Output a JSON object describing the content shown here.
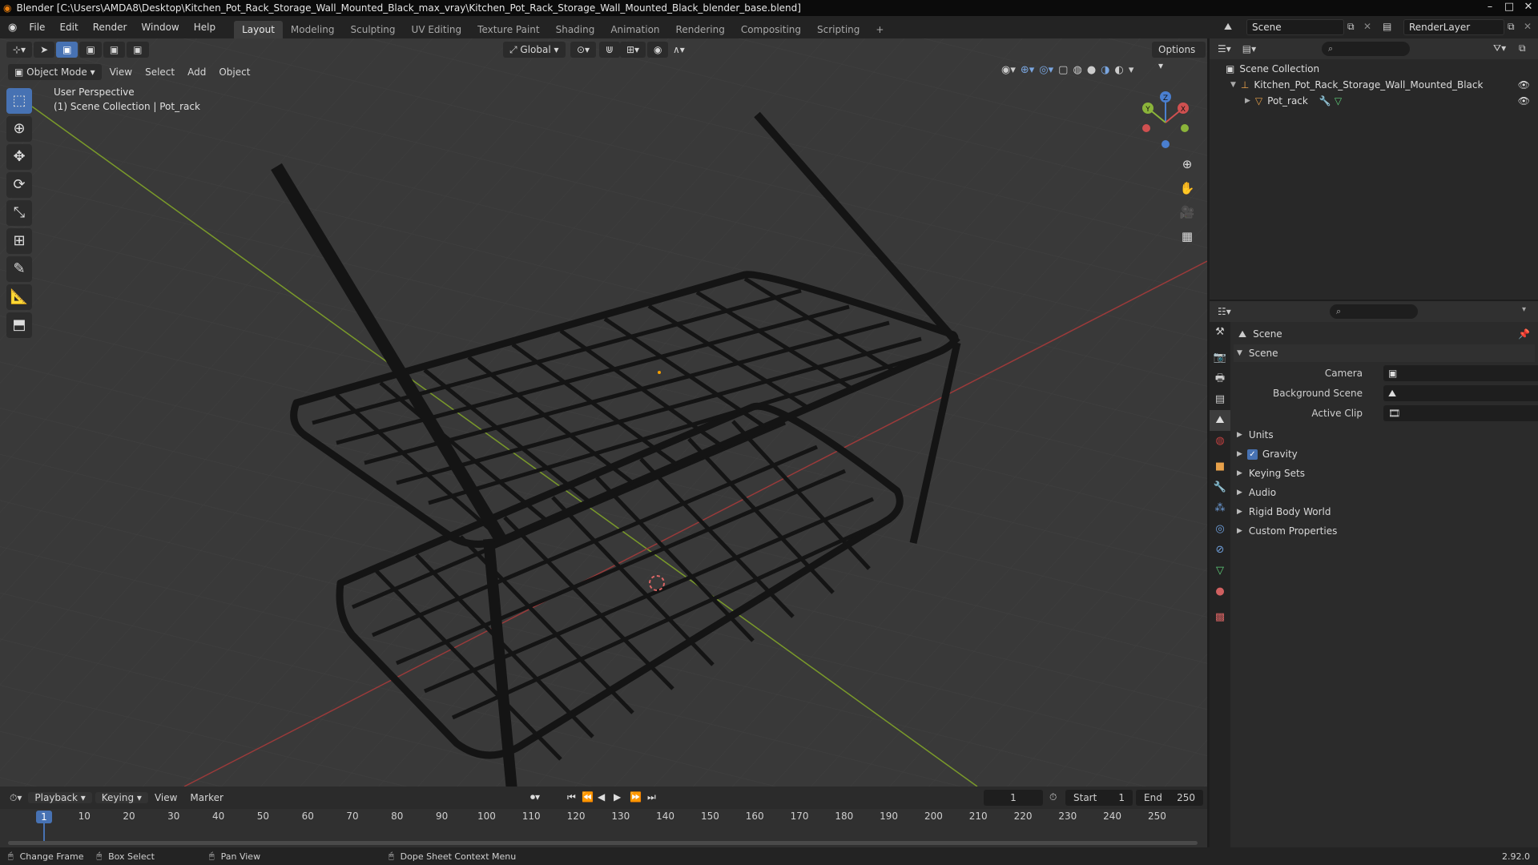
{
  "window": {
    "title": "Blender [C:\\Users\\AMDA8\\Desktop\\Kitchen_Pot_Rack_Storage_Wall_Mounted_Black_max_vray\\Kitchen_Pot_Rack_Storage_Wall_Mounted_Black_blender_base.blend]",
    "minimize": "–",
    "maximize": "□",
    "close": "✕"
  },
  "menubar": {
    "items": [
      "File",
      "Edit",
      "Render",
      "Window",
      "Help"
    ],
    "workspaces": [
      "Layout",
      "Modeling",
      "Sculpting",
      "UV Editing",
      "Texture Paint",
      "Shading",
      "Animation",
      "Rendering",
      "Compositing",
      "Scripting"
    ],
    "active_workspace": "Layout",
    "add_tab": "+",
    "scene_name": "Scene",
    "render_layer": "RenderLayer"
  },
  "viewport": {
    "header": {
      "transform_orientation": "Global",
      "options_label": "Options"
    },
    "header2": {
      "mode": "Object Mode",
      "menus": [
        "View",
        "Select",
        "Add",
        "Object"
      ]
    },
    "info_line1": "User Perspective",
    "info_line2": "(1) Scene Collection | Pot_rack",
    "gizmo_labels": {
      "x": "X",
      "y": "Y",
      "z": "Z"
    },
    "colors": {
      "background": "#393939",
      "x_axis": "#9b3a3a",
      "y_axis": "#7a9a2a",
      "active_tool": "#4772b3"
    }
  },
  "outliner": {
    "root": "Scene Collection",
    "items": [
      {
        "label": "Kitchen_Pot_Rack_Storage_Wall_Mounted_Black"
      },
      {
        "label": "Pot_rack"
      }
    ]
  },
  "properties": {
    "context_title": "Scene",
    "panel_title": "Scene",
    "fields": [
      {
        "label": "Camera"
      },
      {
        "label": "Background Scene"
      },
      {
        "label": "Active Clip"
      }
    ],
    "subpanels": [
      "Units",
      "Gravity",
      "Keying Sets",
      "Audio",
      "Rigid Body World",
      "Custom Properties"
    ],
    "gravity_checked": true
  },
  "timeline": {
    "menus": [
      "Playback",
      "Keying",
      "View",
      "Marker"
    ],
    "current_frame": "1",
    "start_label": "Start",
    "start_value": "1",
    "end_label": "End",
    "end_value": "250",
    "ticks": [
      "1",
      "10",
      "20",
      "30",
      "40",
      "50",
      "60",
      "70",
      "80",
      "90",
      "100",
      "110",
      "120",
      "130",
      "140",
      "150",
      "160",
      "170",
      "180",
      "190",
      "200",
      "210",
      "220",
      "230",
      "240",
      "250"
    ]
  },
  "statusbar": {
    "items": [
      "Change Frame",
      "Box Select",
      "Pan View",
      "Dope Sheet Context Menu"
    ],
    "version": "2.92.0"
  }
}
